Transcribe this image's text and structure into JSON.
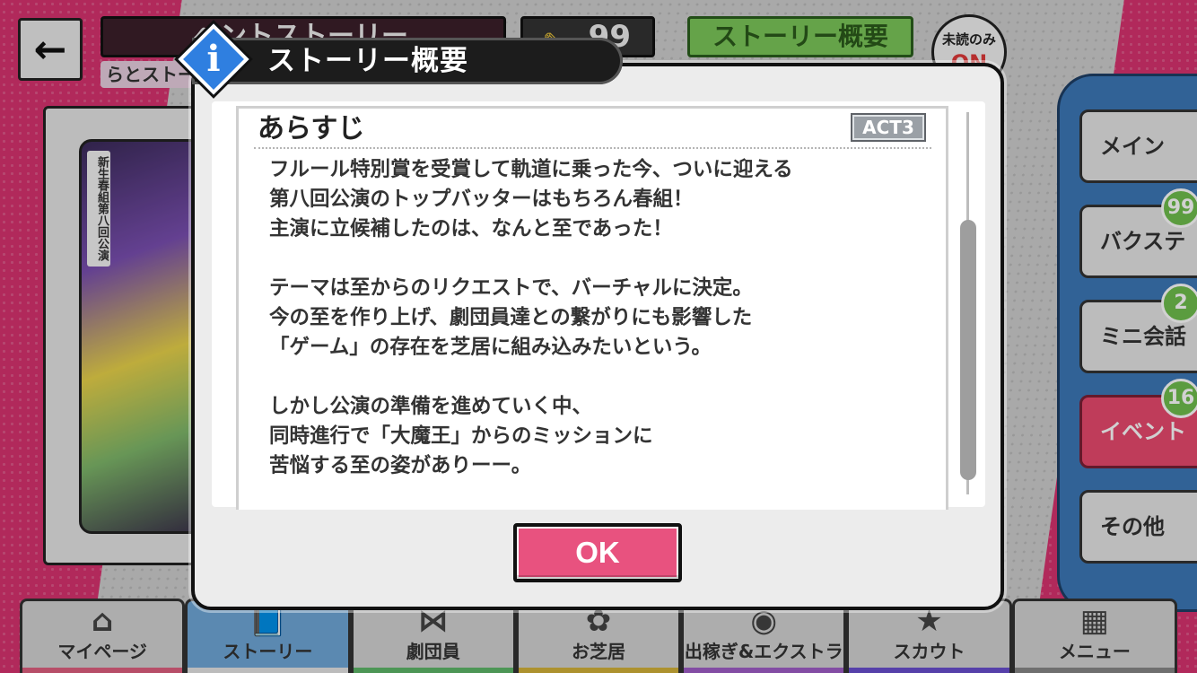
{
  "header": {
    "back_label": "←",
    "story_title": "ベントストーリー",
    "story_subtitle": "らとストー",
    "ticket_count": "99",
    "overview_button": "ストーリー概要",
    "unread_label": "未読のみ",
    "unread_state": "ON"
  },
  "card": {
    "vertical_text": "新生春組第八回公演"
  },
  "side_tabs": [
    {
      "label": "メイン",
      "badge": ""
    },
    {
      "label": "バクステ",
      "badge": "99"
    },
    {
      "label": "ミニ会話",
      "badge": "2"
    },
    {
      "label": "イベント",
      "badge": "16"
    },
    {
      "label": "その他",
      "badge": ""
    }
  ],
  "bottom_nav": [
    {
      "label": "マイページ",
      "icon": "house-icon"
    },
    {
      "label": "ストーリー",
      "icon": "book-icon"
    },
    {
      "label": "劇団員",
      "icon": "bowtie-icon"
    },
    {
      "label": "お芝居",
      "icon": "stage-icon"
    },
    {
      "label": "出稼ぎ&エクストラ",
      "icon": "coins-icon"
    },
    {
      "label": "スカウト",
      "icon": "star-badge-icon"
    },
    {
      "label": "メニュー",
      "icon": "grid-icon"
    }
  ],
  "modal": {
    "title": "ストーリー概要",
    "info_glyph": "i",
    "section_title": "あらすじ",
    "act_badge": "ACT3",
    "synopsis": {
      "p1": [
        "フルール特別賞を受賞して軌道に乗った今、ついに迎える",
        "第八回公演のトップバッターはもちろん春組！",
        "主演に立候補したのは、なんと至であった！"
      ],
      "p2": [
        "テーマは至からのリクエストで、バーチャルに決定。",
        "今の至を作り上げ、劇団員達との繋がりにも影響した",
        "「ゲーム」の存在を芝居に組み込みたいという。"
      ],
      "p3": [
        "しかし公演の準備を進めていく中、",
        "同時進行で「大魔王」からのミッションに",
        "苦悩する至の姿がありーー。"
      ]
    },
    "ok_label": "OK"
  },
  "colors": {
    "accent_pink": "#e8527f",
    "info_blue": "#2f7fe0",
    "tab_blue": "#3c78b8",
    "badge_green": "#6fbf4e"
  }
}
